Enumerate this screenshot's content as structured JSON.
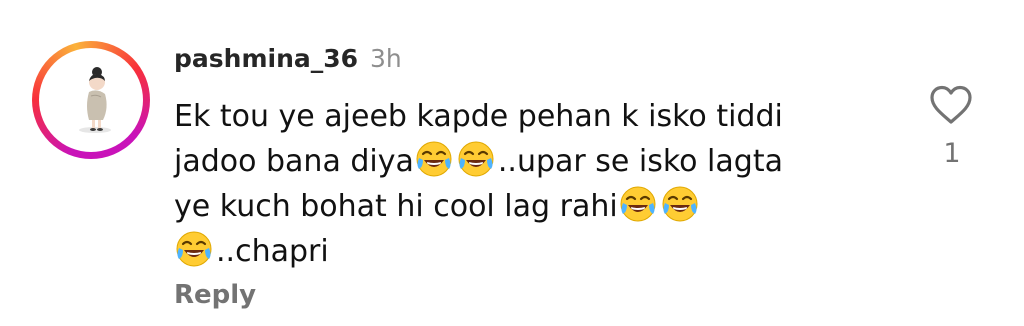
{
  "comment": {
    "username": "pashmina_36",
    "timestamp": "3h",
    "text_parts": {
      "line1": "Ek tou ye ajeeb kapde pehan k isko tiddi",
      "line2_a": "jadoo bana diya",
      "line2_b": "..upar se isko lagta",
      "line3_a": "ye kuch bohat hi cool lag rahi",
      "line4_b": "..chapri"
    },
    "reply_label": "Reply",
    "like_count": "1"
  },
  "icons": {
    "emoji": "face-with-tears-of-joy-icon",
    "like": "heart-outline-icon"
  },
  "colors": {
    "story_ring": [
      "#c913b9",
      "#f8303a",
      "#fbb23a"
    ],
    "username": "#262626",
    "secondary_text": "#8e8e8e",
    "reply": "#737373"
  }
}
